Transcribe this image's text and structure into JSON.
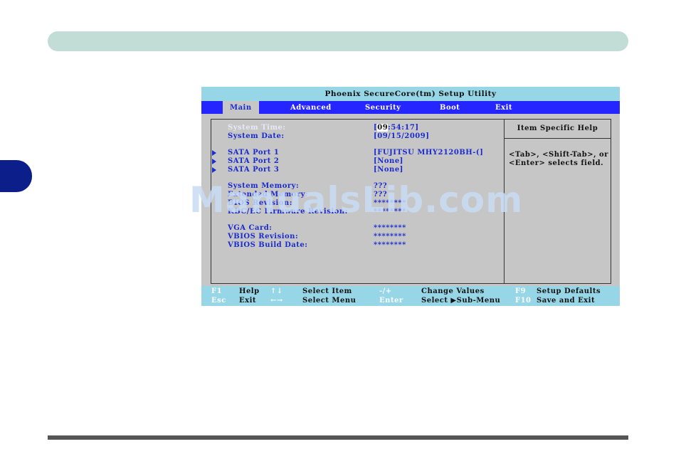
{
  "bios": {
    "title": "Phoenix SecureCore(tm) Setup Utility",
    "menu": [
      "Main",
      "Advanced",
      "Security",
      "Boot",
      "Exit"
    ],
    "help_heading": "Item Specific Help",
    "help_text": "<Tab>, <Shift-Tab>, or\n<Enter> selects field.",
    "rows": {
      "system_time": {
        "label": "System Time:",
        "value_hl": "09",
        "value_rest": ":54:17]",
        "value_open": "["
      },
      "system_date": {
        "label": "System Date:",
        "value": "[09/15/2009]"
      },
      "sata1": {
        "label": "SATA Port 1",
        "value": "[FUJITSU MHY2120BH-(]"
      },
      "sata2": {
        "label": "SATA Port 2",
        "value": "[None]"
      },
      "sata3": {
        "label": "SATA Port 3",
        "value": "[None]"
      },
      "sys_mem": {
        "label": "System Memory:",
        "value": "???"
      },
      "ext_mem": {
        "label": "Extended Memory:",
        "value": "???"
      },
      "bios_rev": {
        "label": "BIOS Revision:",
        "value": "********"
      },
      "kbc": {
        "label": "KBC/EC Firmware Revision:",
        "value": "********"
      },
      "vga": {
        "label": "VGA Card:",
        "value": "********"
      },
      "vbios_rev": {
        "label": "VBIOS Revision:",
        "value": "********"
      },
      "vbios_build": {
        "label": "VBIOS Build Date:",
        "value": "********"
      }
    },
    "footer": [
      {
        "key": "F1",
        "desc": "Help"
      },
      {
        "key": "↑↓",
        "desc": "Select Item"
      },
      {
        "key": "-/+",
        "desc": "Change Values"
      },
      {
        "key": "F9",
        "desc": "Setup Defaults"
      },
      {
        "key": "Esc",
        "desc": "Exit"
      },
      {
        "key": "←→",
        "desc": "Select Menu"
      },
      {
        "key": "Enter",
        "desc": "Select ▶Sub-Menu"
      },
      {
        "key": "F10",
        "desc": "Save and Exit"
      }
    ]
  },
  "watermark": "ManualsLib.com"
}
